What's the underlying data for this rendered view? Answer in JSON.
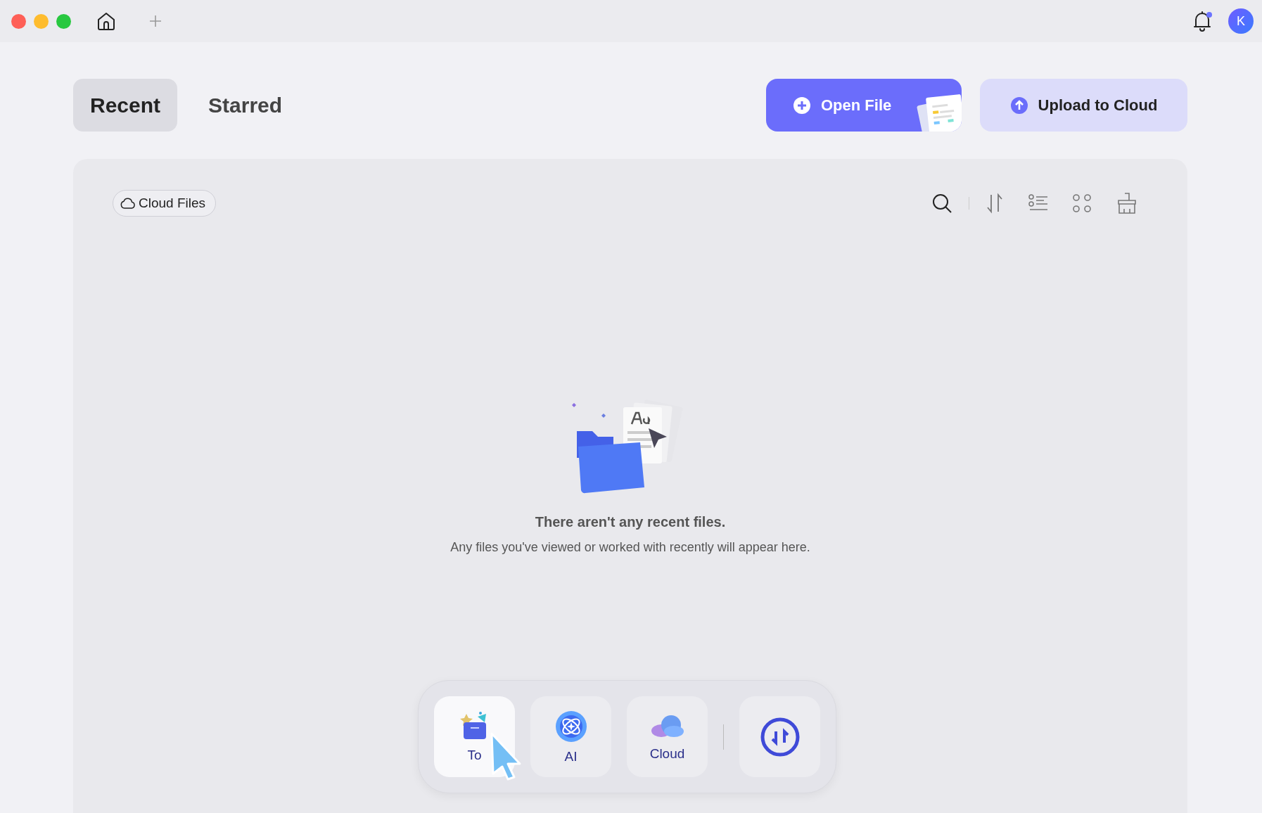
{
  "titlebar": {
    "avatar": "K",
    "notification": true
  },
  "tabs": [
    {
      "label": "Recent",
      "selected": true
    },
    {
      "label": "Starred",
      "selected": false
    }
  ],
  "actions": {
    "open": "Open File",
    "upload": "Upload to Cloud"
  },
  "filter": {
    "label": "Cloud Files"
  },
  "empty": {
    "title": "There aren't any recent files.",
    "message": "Any files you've viewed or worked with recently will appear here."
  },
  "dock": [
    {
      "kind": "tools",
      "label": "To",
      "selected": true
    },
    {
      "kind": "ai",
      "label": "AI",
      "selected": false
    },
    {
      "kind": "cloud",
      "label": "Cloud",
      "selected": false
    },
    {
      "kind": "convert",
      "selected": false
    }
  ]
}
